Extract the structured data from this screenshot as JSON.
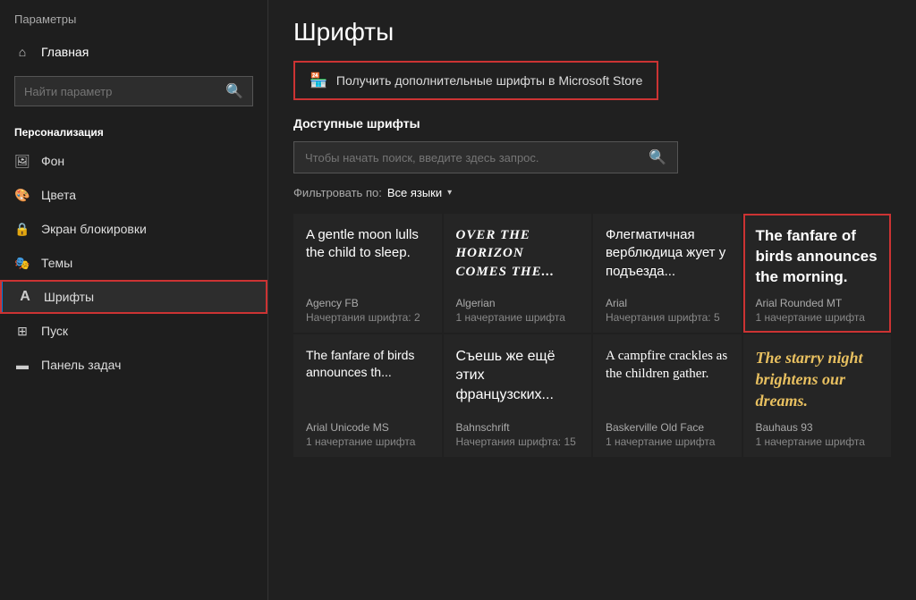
{
  "sidebar": {
    "app_title": "Параметры",
    "home_label": "Главная",
    "search_placeholder": "Найти параметр",
    "section_label": "Персонализация",
    "items": [
      {
        "label": "Фон",
        "icon": "🖼"
      },
      {
        "label": "Цвета",
        "icon": "🎨"
      },
      {
        "label": "Экран блокировки",
        "icon": "🔒"
      },
      {
        "label": "Темы",
        "icon": "🎭"
      },
      {
        "label": "Шрифты",
        "icon": "A",
        "active": true
      },
      {
        "label": "Пуск",
        "icon": "⊞"
      },
      {
        "label": "Панель задач",
        "icon": "▬"
      }
    ]
  },
  "main": {
    "title": "Шрифты",
    "ms_store_button": "Получить дополнительные шрифты в Microsoft Store",
    "available_fonts_label": "Доступные шрифты",
    "search_placeholder": "Чтобы начать поиск, введите здесь запрос.",
    "filter_label": "Фильтровать по:",
    "filter_value": "Все языки",
    "fonts": [
      {
        "preview": "A gentle moon lulls the child to sleep.",
        "name": "Agency FB",
        "styles_label": "Начертания шрифта:",
        "styles_count": "2"
      },
      {
        "preview": "OVER THE HORIZON COMES THE...",
        "name": "Algerian",
        "styles_label": "1 начертание шрифта",
        "styles_count": ""
      },
      {
        "preview": "Флегматичная верблюдица жует у подъезда...",
        "name": "Arial",
        "styles_label": "Начертания шрифта:",
        "styles_count": "5"
      },
      {
        "preview": "The fanfare of birds announces the morning.",
        "name": "Arial Rounded MT",
        "styles_label": "1 начертание шрифта",
        "styles_count": ""
      },
      {
        "preview": "The fanfare of birds announces th...",
        "name": "Arial Unicode MS",
        "styles_label": "1 начертание шрифта",
        "styles_count": ""
      },
      {
        "preview": "Съешь же ещё этих французских...",
        "name": "Bahnschrift",
        "styles_label": "Начертания шрифта:",
        "styles_count": "15"
      },
      {
        "preview": "A campfire crackles as the children gather.",
        "name": "Baskerville Old Face",
        "styles_label": "1 начертание шрифта",
        "styles_count": ""
      },
      {
        "preview": "The starry night brightens our dreams.",
        "name": "Bauhaus 93",
        "styles_label": "1 начертание шрифта",
        "styles_count": ""
      }
    ]
  }
}
